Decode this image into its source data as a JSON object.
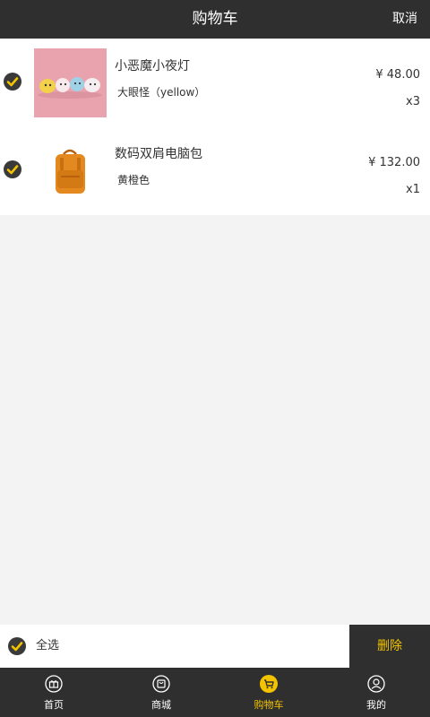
{
  "header": {
    "title": "购物车",
    "action_label": "取消"
  },
  "cart": {
    "items": [
      {
        "name": "小恶魔小夜灯",
        "spec": "大眼怪（yellow）",
        "price": "¥ 48.00",
        "quantity": "x3",
        "selected": true,
        "thumbnail": "night-light-photo"
      },
      {
        "name": "数码双肩电脑包",
        "spec": "黄橙色",
        "price": "¥ 132.00",
        "quantity": "x1",
        "selected": true,
        "thumbnail": "backpack-photo"
      }
    ]
  },
  "bottom_bar": {
    "select_all_label": "全选",
    "select_all_checked": true,
    "delete_label": "删除"
  },
  "tabs": [
    {
      "label": "首页",
      "icon": "gift-icon",
      "active": false
    },
    {
      "label": "商城",
      "icon": "shopping-bag-icon",
      "active": false
    },
    {
      "label": "购物车",
      "icon": "cart-icon",
      "active": true
    },
    {
      "label": "我的",
      "icon": "user-icon",
      "active": false
    }
  ],
  "colors": {
    "dark_bar": "#2f2f2f",
    "accent": "#f3c300",
    "background": "#f3f3f3"
  }
}
